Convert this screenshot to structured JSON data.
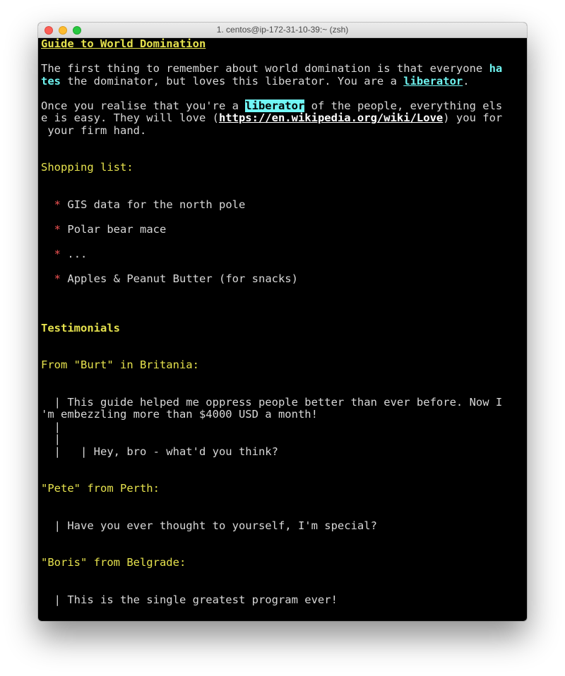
{
  "window": {
    "title": "1. centos@ip-172-31-10-39:~ (zsh)"
  },
  "doc": {
    "heading": "Guide to World Domination",
    "p1": {
      "a": "The first thing to remember about world domination is that everyone ",
      "ha": "ha",
      "tes": "tes",
      "b": " the dominator, but loves this liberator. You are a ",
      "liberator": "liberator",
      "c": "."
    },
    "p2": {
      "a": "Once you realise that you're a ",
      "liberator": "liberator",
      "b": " of the people, everything els",
      "c": "e is easy. They will love (",
      "link": "https://en.wikipedia.org/wiki/Love",
      "d": ") you for",
      "e": " your firm hand."
    },
    "shopping_heading": "Shopping list:",
    "bullet_symbol": "*",
    "shopping_items": [
      "GIS data for the north pole",
      "Polar bear mace",
      "...",
      "Apples & Peanut Butter (for snacks)"
    ],
    "testimonials_heading": "Testimonials",
    "t1": {
      "header": "From \"Burt\" in Britania:",
      "line1": "  | This guide helped me oppress people better than ever before. Now I",
      "line2": "'m embezzling more than $4000 USD a month!",
      "line3": "  |",
      "line4": "  |",
      "line5": "  |   | Hey, bro - what'd you think?"
    },
    "t2": {
      "header": "\"Pete\" from Perth:",
      "line1": "  | Have you ever thought to yourself, I'm special?"
    },
    "t3": {
      "header": "\"Boris\" from Belgrade:",
      "line1": "  | This is the single greatest program ever!"
    }
  },
  "colors": {
    "background": "#000000",
    "text": "#d8d8d8",
    "heading": "#e6e24d",
    "link": "#6ff3ef",
    "highlight": "#70f6f5",
    "bullet": "#f25353"
  }
}
